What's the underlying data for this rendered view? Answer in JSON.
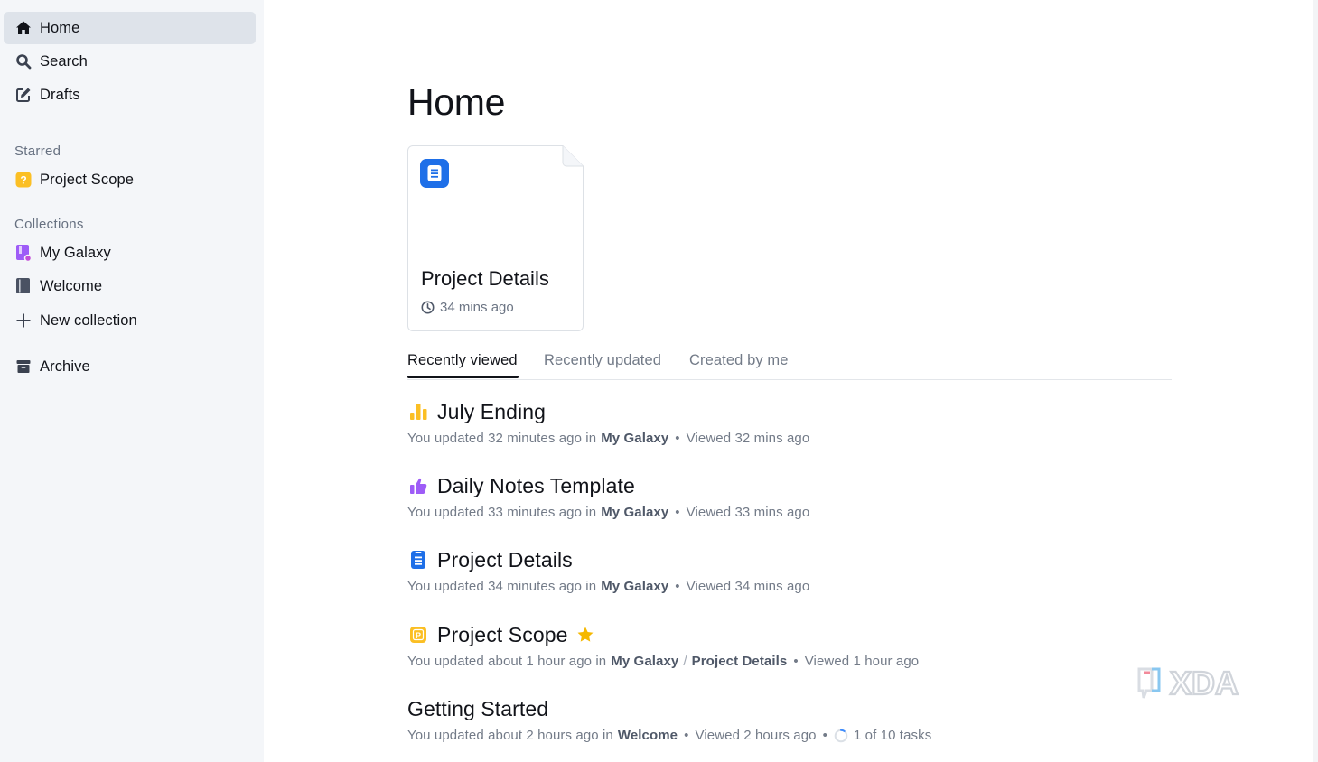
{
  "sidebar": {
    "nav": [
      {
        "label": "Home",
        "icon": "home-icon"
      },
      {
        "label": "Search",
        "icon": "search-icon"
      },
      {
        "label": "Drafts",
        "icon": "edit-icon"
      }
    ],
    "starred_header": "Starred",
    "starred": [
      {
        "label": "Project Scope",
        "icon": "question-badge-icon"
      }
    ],
    "collections_header": "Collections",
    "collections": [
      {
        "label": "My Galaxy",
        "icon": "collection-purple-icon",
        "color": "#9e5cf7"
      },
      {
        "label": "Welcome",
        "icon": "book-icon",
        "color": "#4a5263"
      }
    ],
    "new_collection": "New collection",
    "archive": "Archive"
  },
  "main": {
    "title": "Home",
    "pinned_card": {
      "title": "Project Details",
      "time": "34 mins ago",
      "icon": "document-icon",
      "color": "#1e6fe8"
    },
    "tabs": [
      "Recently viewed",
      "Recently updated",
      "Created by me"
    ],
    "documents": [
      {
        "title": "July Ending",
        "icon": "bar-chart-icon",
        "prefix": "You updated 32 minutes ago in",
        "collection": "My Galaxy",
        "viewed": "Viewed 32 mins ago"
      },
      {
        "title": "Daily Notes Template",
        "icon": "thumbs-up-icon",
        "prefix": "You updated 33 minutes ago in",
        "collection": "My Galaxy",
        "viewed": "Viewed 33 mins ago"
      },
      {
        "title": "Project Details",
        "icon": "document-icon",
        "prefix": "You updated 34 minutes ago in",
        "collection": "My Galaxy",
        "viewed": "Viewed 34 mins ago"
      },
      {
        "title": "Project Scope",
        "icon": "p-badge-icon",
        "prefix": "You updated about 1 hour ago in",
        "collection": "My Galaxy",
        "parent": "Project Details",
        "viewed": "Viewed 1 hour ago",
        "starred": true
      },
      {
        "title": "Getting Started",
        "prefix": "You updated about 2 hours ago in",
        "collection": "Welcome",
        "viewed": "Viewed 2 hours ago",
        "tasks": "1 of 10 tasks",
        "tasks_progress": 0.1
      }
    ]
  },
  "watermark": {
    "text": "XDA"
  },
  "colors": {
    "accent": "#1e6fe8",
    "sidebar_bg": "#f4f6f9",
    "star": "#f5b800",
    "purple": "#9e5cf7",
    "yellow": "#fbbf24"
  }
}
